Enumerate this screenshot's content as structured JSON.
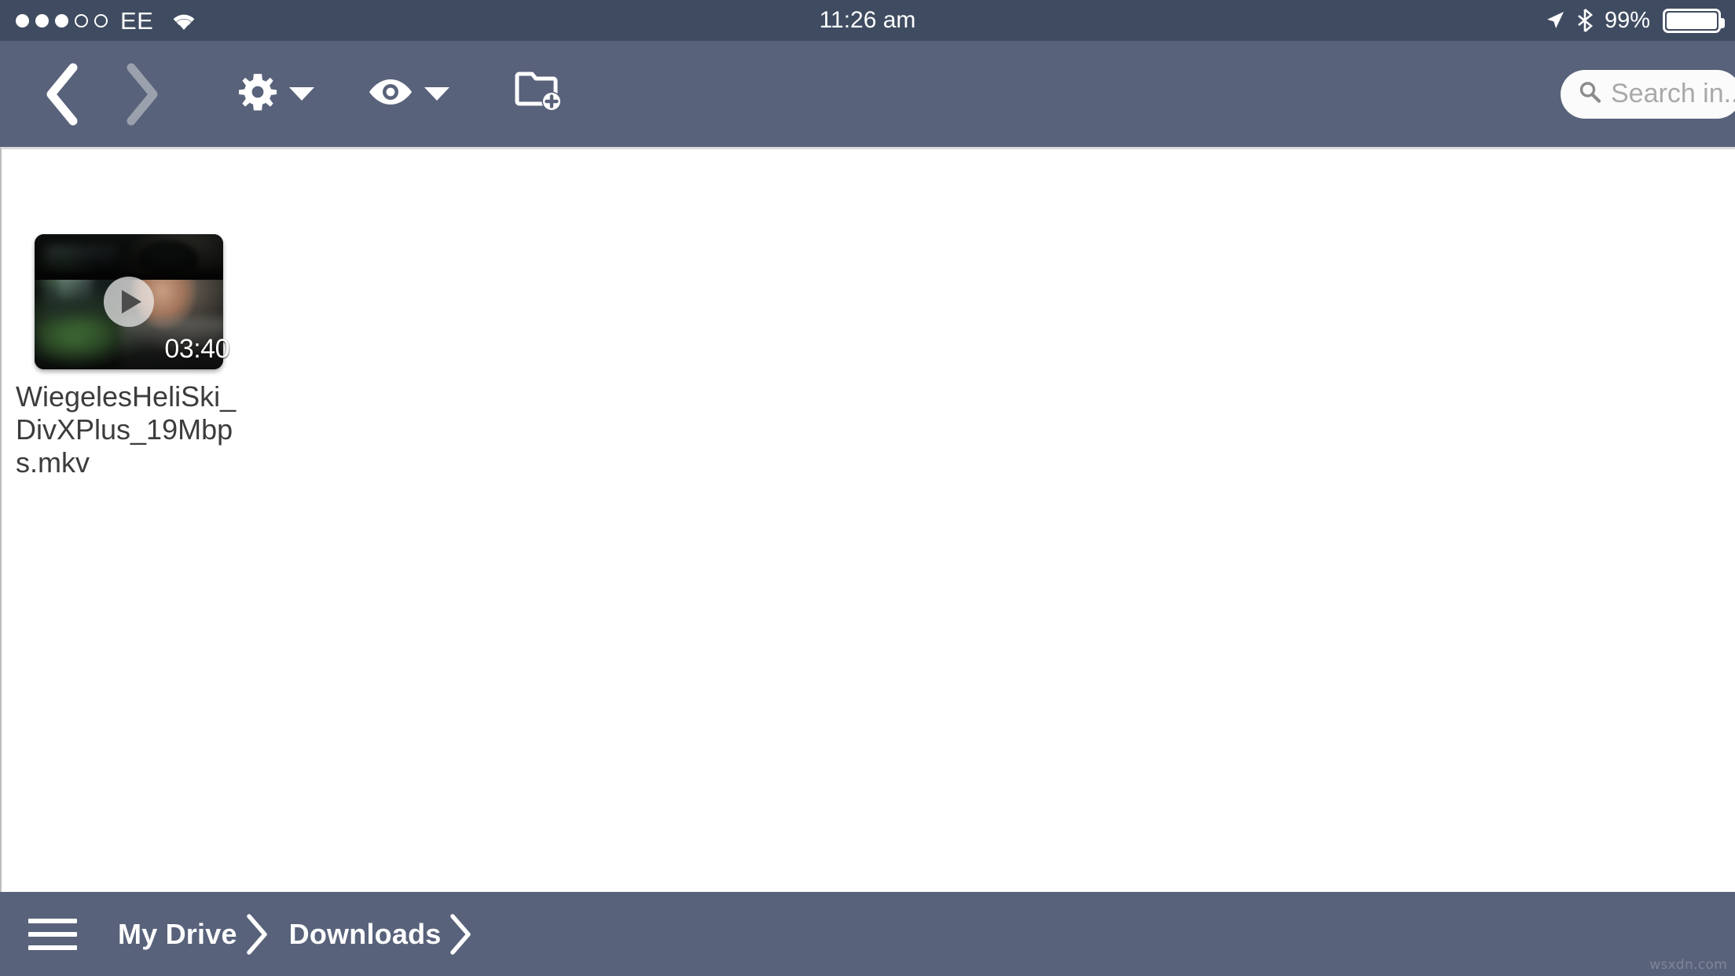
{
  "statusbar": {
    "carrier": "EE",
    "signal_dots_total": 5,
    "signal_dots_filled": 3,
    "wifi_icon": "wifi-icon",
    "clock": "11:26 am",
    "location_icon": "location-arrow-icon",
    "bluetooth_icon": "bluetooth-icon",
    "battery_percent": "99%",
    "battery_level": 99,
    "background_color": "#3f4b60",
    "text_color": "#ffffff"
  },
  "toolbar": {
    "background_color": "#58627a",
    "back_icon": "chevron-left-icon",
    "back_enabled": true,
    "forward_icon": "chevron-right-icon",
    "forward_enabled": false,
    "settings_icon": "gear-icon",
    "settings_caret": "caret-down-icon",
    "view_icon": "eye-icon",
    "view_caret": "caret-down-icon",
    "new_folder_icon": "folder-plus-icon",
    "search": {
      "icon": "search-icon",
      "placeholder": "Search in...",
      "value": ""
    }
  },
  "content": {
    "background_color": "#ffffff",
    "files": [
      {
        "name": "WiegelesHeliSki_DivXPlus_19Mbps.mkv",
        "type": "video",
        "duration": "03:40",
        "play_icon": "play-icon",
        "thumbnail_alt": "man in dark beanie in front of blurred monitor and greenery"
      }
    ]
  },
  "breadcrumb_bar": {
    "background_color": "#58627a",
    "menu_icon": "hamburger-menu-icon",
    "crumbs": [
      {
        "label": "My Drive",
        "separator": "chevron-right-icon"
      },
      {
        "label": "Downloads",
        "separator": "chevron-right-icon"
      }
    ]
  },
  "watermark": "wsxdn.com"
}
